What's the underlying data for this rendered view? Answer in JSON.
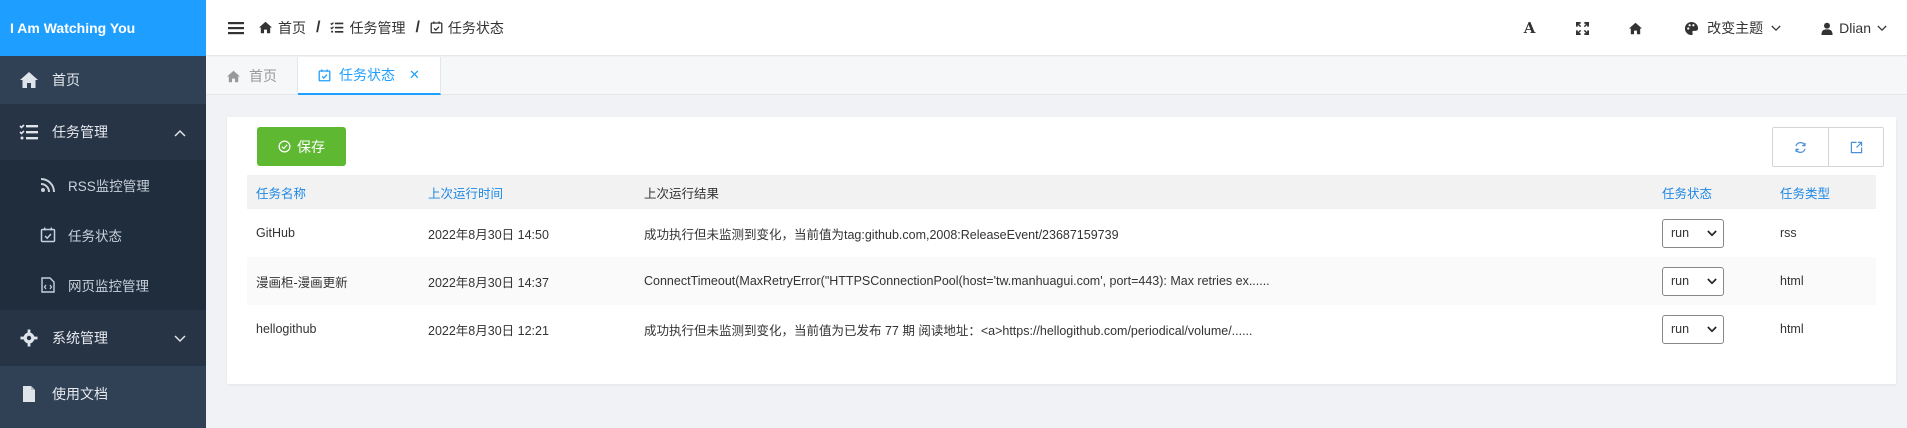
{
  "app": {
    "title": "I Am Watching You"
  },
  "sidebar": {
    "items": [
      {
        "label": "首页",
        "icon": "home-icon"
      },
      {
        "label": "任务管理",
        "icon": "list-check-icon",
        "expanded": true,
        "children": [
          {
            "label": "RSS监控管理",
            "icon": "rss-icon"
          },
          {
            "label": "任务状态",
            "icon": "calendar-check-icon"
          },
          {
            "label": "网页监控管理",
            "icon": "file-code-icon"
          }
        ]
      },
      {
        "label": "系统管理",
        "icon": "gear-icon",
        "expanded": false
      },
      {
        "label": "使用文档",
        "icon": "file-icon"
      }
    ]
  },
  "header": {
    "breadcrumbs": [
      "首页",
      "任务管理",
      "任务状态"
    ],
    "theme_label": "改变主题",
    "user": "Dlian"
  },
  "tabs": [
    {
      "label": "首页",
      "active": false
    },
    {
      "label": "任务状态",
      "active": true
    }
  ],
  "toolbar": {
    "save_label": "保存"
  },
  "table": {
    "headers": [
      "任务名称",
      "上次运行时间",
      "上次运行结果",
      "任务状态",
      "任务类型"
    ],
    "rows": [
      {
        "name": "GitHub",
        "time": "2022年8月30日 14:50",
        "result": "成功执行但未监测到变化，当前值为tag:github.com,2008:ReleaseEvent/23687159739",
        "status": "run",
        "type": "rss"
      },
      {
        "name": "漫画柜-漫画更新",
        "time": "2022年8月30日 14:37",
        "result": "ConnectTimeout(MaxRetryError(\"HTTPSConnectionPool(host='tw.manhuagui.com', port=443): Max retries ex......",
        "status": "run",
        "type": "html"
      },
      {
        "name": "hellogithub",
        "time": "2022年8月30日 12:21",
        "result": "成功执行但未监测到变化，当前值为已发布 77 期 阅读地址：<a>https://hellogithub.com/periodical/volume/......",
        "status": "run",
        "type": "html"
      }
    ]
  },
  "colors": {
    "accent": "#1e9fff",
    "sidebar_bg": "#304156",
    "save_green": "#5fb832"
  }
}
